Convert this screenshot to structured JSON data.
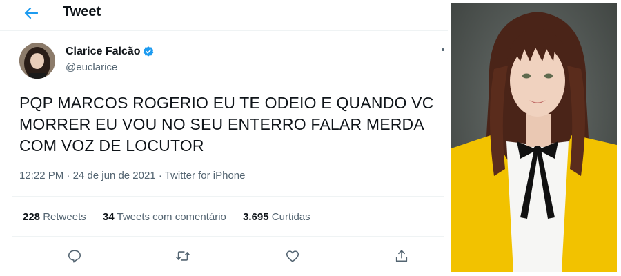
{
  "header": {
    "title": "Tweet",
    "back_icon": "arrow-left-icon"
  },
  "author": {
    "name": "Clarice Falcão",
    "handle": "@euclarice",
    "verified": true,
    "verified_icon": "verified-badge-icon"
  },
  "tweet": {
    "text": "PQP MARCOS ROGERIO EU TE ODEIO E QUANDO VC MORRER EU VOU NO SEU ENTERRO FALAR MERDA COM VOZ DE LOCUTOR",
    "time": "12:22 PM",
    "separator": "·",
    "date": "24 de jun de 2021",
    "source": "Twitter for iPhone"
  },
  "stats": {
    "retweets_count": "228",
    "retweets_label": "Retweets",
    "quotes_count": "34",
    "quotes_label": "Tweets com comentário",
    "likes_count": "3.695",
    "likes_label": "Curtidas"
  },
  "actions": [
    {
      "icon": "reply-icon"
    },
    {
      "icon": "retweet-icon"
    },
    {
      "icon": "like-icon"
    },
    {
      "icon": "share-icon"
    }
  ],
  "colors": {
    "accent": "#1d9bf0",
    "text": "#0f1419",
    "secondary": "#536471",
    "divider": "#eff3f4",
    "photo_background": "#4e5452",
    "jacket": "#f2c200"
  }
}
